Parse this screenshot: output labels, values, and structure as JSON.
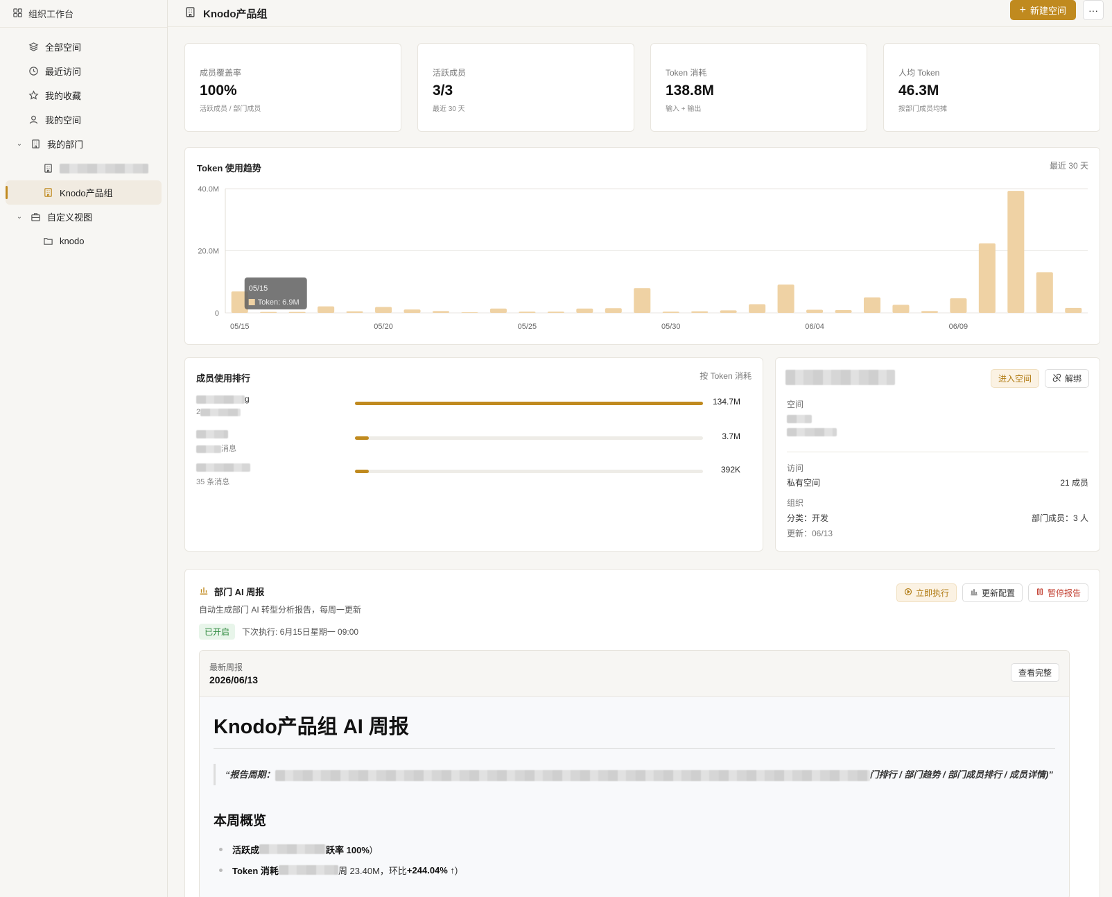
{
  "sidebar": {
    "header": "组织工作台",
    "items": [
      {
        "label": "全部空间"
      },
      {
        "label": "最近访问"
      },
      {
        "label": "我的收藏"
      },
      {
        "label": "我的空间"
      }
    ],
    "group_dept": {
      "label": "我的部门",
      "children": [
        {
          "label": ""
        },
        {
          "label": "Knodo产品组"
        }
      ]
    },
    "group_custom": {
      "label": "自定义视图",
      "children": [
        {
          "label": "knodo"
        }
      ]
    }
  },
  "topbar": {
    "title": "Knodo产品组",
    "new_space": "新建空间",
    "more": "···"
  },
  "stats": [
    {
      "label": "成员覆盖率",
      "value": "100%",
      "sub": "活跃成员 / 部门成员"
    },
    {
      "label": "活跃成员",
      "value": "3/3",
      "sub": "最近 30 天"
    },
    {
      "label": "Token 消耗",
      "value": "138.8M",
      "sub": "输入 + 输出"
    },
    {
      "label": "人均 Token",
      "value": "46.3M",
      "sub": "按部门成员均摊"
    }
  ],
  "trend": {
    "title": "Token 使用趋势",
    "range": "最近 30 天",
    "tooltip": {
      "date": "05/15",
      "text": "Token: 6.9M"
    }
  },
  "chart_data": {
    "type": "bar",
    "title": "Token 使用趋势",
    "categories": [
      "05/15",
      "05/16",
      "05/17",
      "05/18",
      "05/19",
      "05/20",
      "05/21",
      "05/22",
      "05/23",
      "05/24",
      "05/25",
      "05/26",
      "05/27",
      "05/28",
      "05/29",
      "05/30",
      "05/31",
      "06/01",
      "06/02",
      "06/03",
      "06/04",
      "06/05",
      "06/06",
      "06/07",
      "06/08",
      "06/09",
      "06/10",
      "06/11",
      "06/12",
      "06/13"
    ],
    "values": [
      6.9,
      0.3,
      0.3,
      2.1,
      0.5,
      1.9,
      1.1,
      0.6,
      0.2,
      1.4,
      0.4,
      0.4,
      1.4,
      1.5,
      8.0,
      0.4,
      0.5,
      0.8,
      2.8,
      9.1,
      1.0,
      0.9,
      5.0,
      2.6,
      0.6,
      4.7,
      22.4,
      39.3,
      13.1,
      1.6
    ],
    "x_tick_labels": [
      "05/15",
      "05/20",
      "05/25",
      "05/30",
      "06/04",
      "06/09"
    ],
    "y_tick_labels": [
      "0",
      "20.0M",
      "40.0M"
    ],
    "ylim": [
      0,
      40
    ],
    "grid": true,
    "color": "#efd2a4"
  },
  "ranking": {
    "title": "成员使用排行",
    "sort": "按 Token 消耗",
    "rows": [
      {
        "name": "g",
        "sub": "2",
        "value": "134.7M",
        "ratio": 1.0
      },
      {
        "name": "",
        "sub": "消息",
        "value": "3.7M",
        "ratio": 0.04
      },
      {
        "name": "",
        "sub": "35 条消息",
        "value": "392K",
        "ratio": 0.04
      }
    ]
  },
  "detail": {
    "enter": "进入空间",
    "unbind": "解绑",
    "space_label": "空间",
    "access_label": "访问",
    "access_value": "私有空间",
    "members": "21 成员",
    "org_label": "组织",
    "category": "分类：开发",
    "dept_members": "部门成员：3 人",
    "updated": "更新：06/13"
  },
  "report": {
    "title": "部门 AI 周报",
    "desc": "自动生成部门 AI 转型分析报告，每周一更新",
    "status": "已开启",
    "next_run": "下次执行: 6月15日星期一 09:00",
    "run_now": "立即执行",
    "update_config": "更新配置",
    "pause": "暂停报告",
    "latest_label": "最新周报",
    "latest_date": "2026/06/13",
    "view_full": "查看完整",
    "doc_title": "Knodo产品组 AI 周报",
    "quote_prefix": "“报告周期：",
    "quote_suffix": "门排行 / 部门趋势 / 部门成员排行 / 成员详情)”",
    "overview": "本周概览",
    "bullet1_a": "活跃成",
    "bullet1_b": "跃率 100%",
    "bullet1_c": ")",
    "bullet2_a": "Token 消耗",
    "bullet2_b": "周 23.40M，环比 ",
    "bullet2_c": "+244.04% ↑",
    "bullet2_d": ")"
  }
}
